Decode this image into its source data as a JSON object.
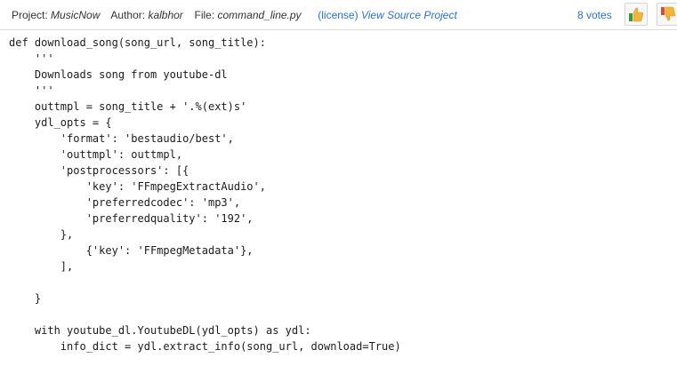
{
  "header": {
    "project_key": "Project:",
    "project_value": "MusicNow",
    "author_key": "Author:",
    "author_value": "kalbhor",
    "file_key": "File:",
    "file_value": "command_line.py",
    "license_link": "(license)",
    "source_link": "View Source Project",
    "votes_label": "8 votes",
    "vote_up_icon": "thumbs-up-icon",
    "vote_down_icon": "thumbs-down-icon",
    "accent_color": "#2a6fd6"
  },
  "code": {
    "lines": [
      "def download_song(song_url, song_title):",
      "    '''",
      "    Downloads song from youtube-dl",
      "    '''",
      "    outtmpl = song_title + '.%(ext)s'",
      "    ydl_opts = {",
      "        'format': 'bestaudio/best',",
      "        'outtmpl': outtmpl,",
      "        'postprocessors': [{",
      "            'key': 'FFmpegExtractAudio',",
      "            'preferredcodec': 'mp3',",
      "            'preferredquality': '192',",
      "        },",
      "            {'key': 'FFmpegMetadata'},",
      "        ],",
      "",
      "    }",
      "",
      "    with youtube_dl.YoutubeDL(ydl_opts) as ydl:",
      "        info_dict = ydl.extract_info(song_url, download=True)"
    ]
  }
}
